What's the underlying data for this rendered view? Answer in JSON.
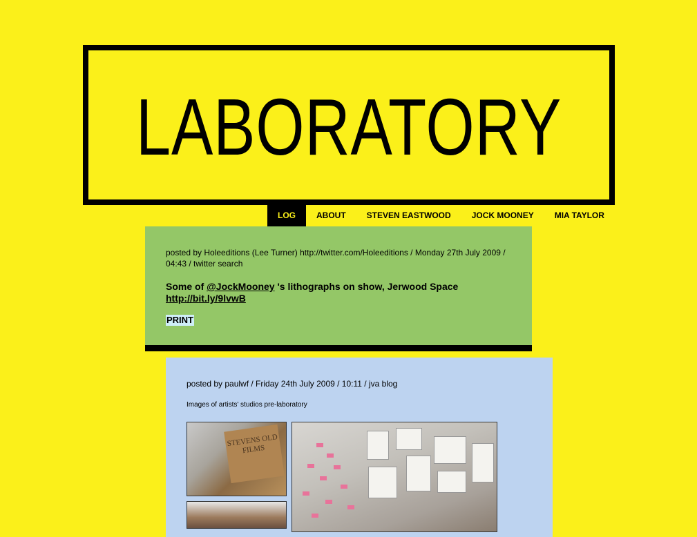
{
  "site": {
    "title": "LABORATORY"
  },
  "nav": {
    "items": [
      {
        "label": "LOG",
        "active": true
      },
      {
        "label": "ABOUT",
        "active": false
      },
      {
        "label": "STEVEN EASTWOOD",
        "active": false
      },
      {
        "label": "JOCK MOONEY",
        "active": false
      },
      {
        "label": "MIA TAYLOR",
        "active": false
      }
    ]
  },
  "posts": [
    {
      "meta": "posted by Holeeditions (Lee Turner) http://twitter.com/Holeeditions / Monday 27th July 2009 / 04:43 / twitter search",
      "headline": {
        "before": "Some of ",
        "mention": "@JockMooney",
        "middle": " 's lithographs on show, Jerwood Space ",
        "link": "http://bit.ly/9lvwB"
      },
      "tag": "PRINT",
      "bg_color": "#94c767"
    },
    {
      "meta": "posted by paulwf / Friday 24th July 2009 / 10:11 / jva blog",
      "caption": "Images of artists' studios pre-laboratory",
      "photo_text": "STEVENS OLD FILMS",
      "bg_color": "#bdd3f0"
    }
  ],
  "colors": {
    "page_bg": "#fbf01a",
    "accent": "#000000"
  }
}
